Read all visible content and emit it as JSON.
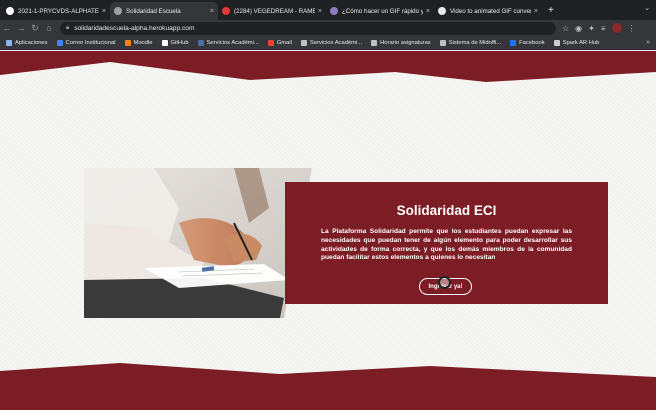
{
  "browser": {
    "tabs": [
      {
        "label": "2021-1-PRYCVDS-ALPHATE",
        "icon": "github-icon",
        "color": "#ffffff",
        "active": false
      },
      {
        "label": "Solidaridad Escuela",
        "icon": "globe-icon",
        "color": "#9aa0a6",
        "active": true
      },
      {
        "label": "(2284) VEGEDREAM - RAMEN",
        "icon": "youtube-icon",
        "color": "#e53935",
        "active": false
      },
      {
        "label": "¿Cómo hacer un GIF rápido y ¿",
        "icon": "image-icon",
        "color": "#8e7cc3",
        "active": false
      },
      {
        "label": "Video to animated GIF conver",
        "icon": "doc-icon",
        "color": "#e8eaed",
        "active": false
      }
    ],
    "new_tab": "+",
    "url": "solidaridadescuela-alpha.herokuapp.com",
    "bookmarks": [
      {
        "label": "Aplicaciones",
        "icon": "apps-grid-icon",
        "color": "#8ab4f8"
      },
      {
        "label": "Correo Institucional",
        "icon": "mail-icon",
        "color": "#4285f4"
      },
      {
        "label": "Moodle",
        "icon": "moodle-icon",
        "color": "#f98012"
      },
      {
        "label": "GitHub",
        "icon": "github-icon",
        "color": "#ffffff"
      },
      {
        "label": "Servicios Académi...",
        "icon": "bookmark-icon",
        "color": "#4a6fa5"
      },
      {
        "label": "Gmail",
        "icon": "gmail-icon",
        "color": "#ea4335"
      },
      {
        "label": "Servicios Académi...",
        "icon": "globe-icon",
        "color": "#bdc1c6"
      },
      {
        "label": "Horario asignaturas",
        "icon": "globe-icon",
        "color": "#bdc1c6"
      },
      {
        "label": "Sistema de Midoffi...",
        "icon": "globe-icon",
        "color": "#bdc1c6"
      },
      {
        "label": "Facebook",
        "icon": "facebook-icon",
        "color": "#1877f2"
      },
      {
        "label": "Spark AR Hub",
        "icon": "spark-icon",
        "color": "#cccccc"
      }
    ],
    "bookmarks_more": "»"
  },
  "hero": {
    "title": "Solidaridad ECI",
    "description": "La Plataforma Solidaridad permite que los estudiantes puedan expresar las necesidades que puedan tener de algún elemento para poder desarrollar sus actividades de forma correcta, y que los demás miembros de la comunidad puedan facilitar estos elementos a quienes lo necesitan",
    "button_label": "Ingresar ya!",
    "image_icon": "student-writing-photo"
  },
  "colors": {
    "brand": "#7c1c24",
    "page_bg": "#f4f4f2",
    "chrome_dark": "#202124",
    "chrome_mid": "#35363a"
  }
}
